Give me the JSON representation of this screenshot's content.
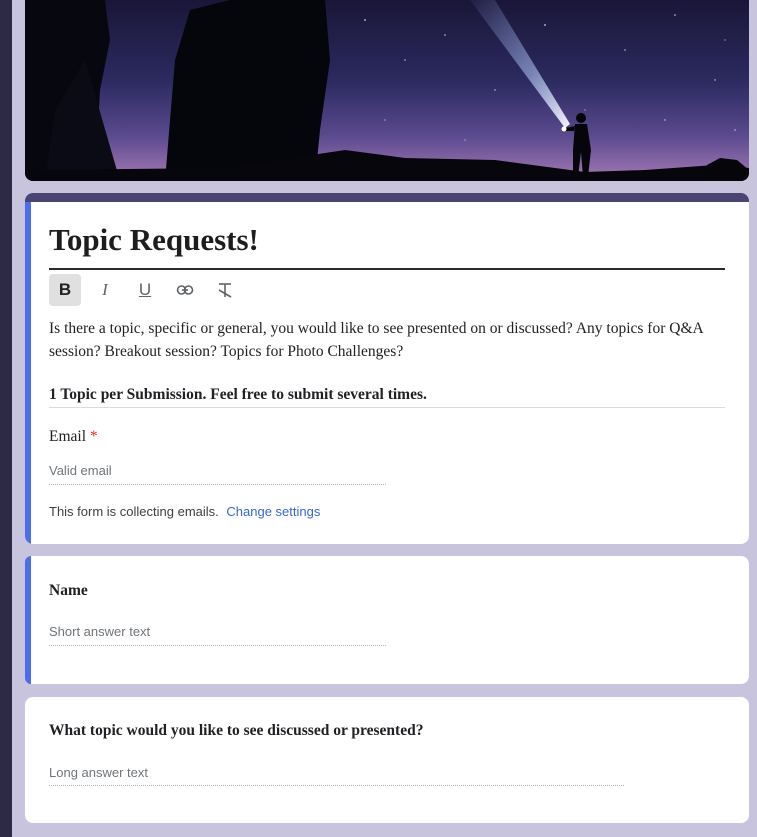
{
  "header": {},
  "form": {
    "title": "Topic Requests!",
    "toolbar": {
      "bold": "B",
      "italic": "I",
      "underline": "U",
      "link": "⊖",
      "clear_format": "T"
    },
    "description": "Is there a topic, specific or general, you would like to see presented on or discussed? Any topics for Q&A session? Breakout session? Topics for Photo Challenges?",
    "note": "1 Topic per Submission. Feel free to submit several times.",
    "email_label": "Email",
    "email_required": "*",
    "email_placeholder": "Valid email",
    "collecting_text": "This form is collecting emails.",
    "change_settings": "Change settings"
  },
  "questions": [
    {
      "label": "Name",
      "placeholder": "Short answer text"
    },
    {
      "label": "What topic would you like to see discussed or presented?",
      "placeholder": "Long answer text"
    }
  ],
  "colors": {
    "accent": "#4a6df0",
    "header_bar": "#4a4473",
    "background": "#c9c4dd",
    "link": "#3566d6",
    "required": "#d93025"
  }
}
